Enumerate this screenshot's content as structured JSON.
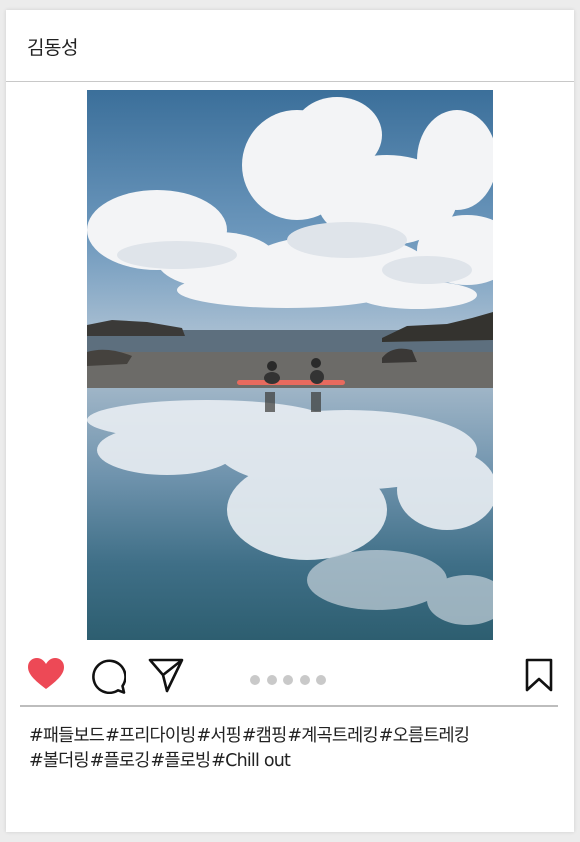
{
  "post": {
    "username": "김동성",
    "photo_icon": "photo-lake-reflection",
    "actions": {
      "like": {
        "icon": "heart-icon",
        "liked": true,
        "color": "#ed4956"
      },
      "comment": {
        "icon": "comment-icon"
      },
      "share": {
        "icon": "paper-plane-icon"
      },
      "save": {
        "icon": "bookmark-icon"
      }
    },
    "carousel": {
      "count": 5,
      "active": 0
    },
    "hashtags": [
      "#패들보드",
      "#프리다이빙",
      "#서핑",
      "#캠핑",
      "#계곡트레킹",
      "#오름트레킹",
      "#볼더링",
      "#플로깅",
      "#플로빙",
      "#Chill out"
    ]
  }
}
